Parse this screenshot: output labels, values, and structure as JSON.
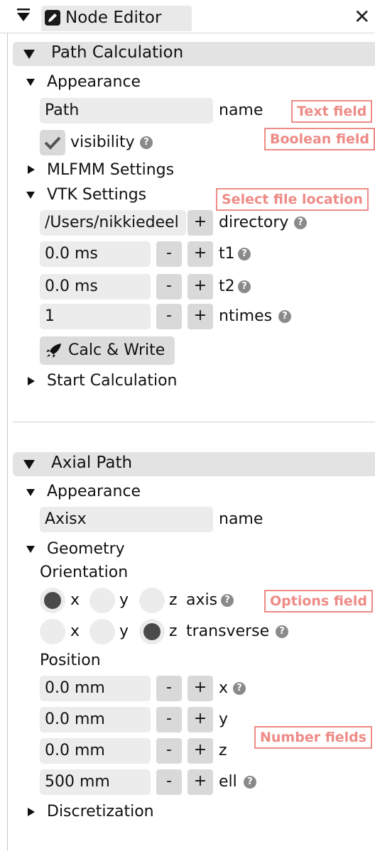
{
  "window": {
    "tab_title": "Node Editor",
    "close_glyph": "✕"
  },
  "path_calc": {
    "title": "Path Calculation",
    "appearance": {
      "label": "Appearance",
      "name_value": "Path",
      "name_label": "name",
      "visibility_label": "visibility",
      "visibility_checked": true
    },
    "mlfmm_label": "MLFMM Settings",
    "vtk": {
      "label": "VTK Settings",
      "directory_value": "/Users/nikkiedeel",
      "directory_label": "directory",
      "t1_value": "0.0 ms",
      "t1_label": "t1",
      "t2_value": "0.0 ms",
      "t2_label": "t2",
      "ntimes_value": "1",
      "ntimes_label": "ntimes",
      "calc_button": "Calc & Write"
    },
    "start_calc_label": "Start Calculation"
  },
  "axial": {
    "title": "Axial Path",
    "appearance": {
      "label": "Appearance",
      "name_value": "Axisx",
      "name_label": "name"
    },
    "geometry": {
      "label": "Geometry",
      "orientation_label": "Orientation",
      "axis": {
        "options": [
          "x",
          "y",
          "z"
        ],
        "selected": "x",
        "label": "axis"
      },
      "transverse": {
        "options": [
          "x",
          "y",
          "z"
        ],
        "selected": "z",
        "label": "transverse"
      },
      "position_label": "Position",
      "x_value": "0.0 mm",
      "x_label": "x",
      "y_value": "0.0 mm",
      "y_label": "y",
      "z_value": "0.0 mm",
      "z_label": "z",
      "ell_value": "500 mm",
      "ell_label": "ell"
    },
    "discretization_label": "Discretization"
  },
  "controls": {
    "minus": "-",
    "plus": "+",
    "help": "?"
  },
  "annotations": {
    "text_field": "Text field",
    "boolean_field": "Boolean field",
    "select_file": "Select file location",
    "options_field": "Options field",
    "number_fields": "Number fields"
  },
  "colors": {
    "annotation": "#ee8b86",
    "section_bar": "#e3e3e3",
    "field_bg": "#ececec",
    "button_bg": "#d9d9d9"
  }
}
